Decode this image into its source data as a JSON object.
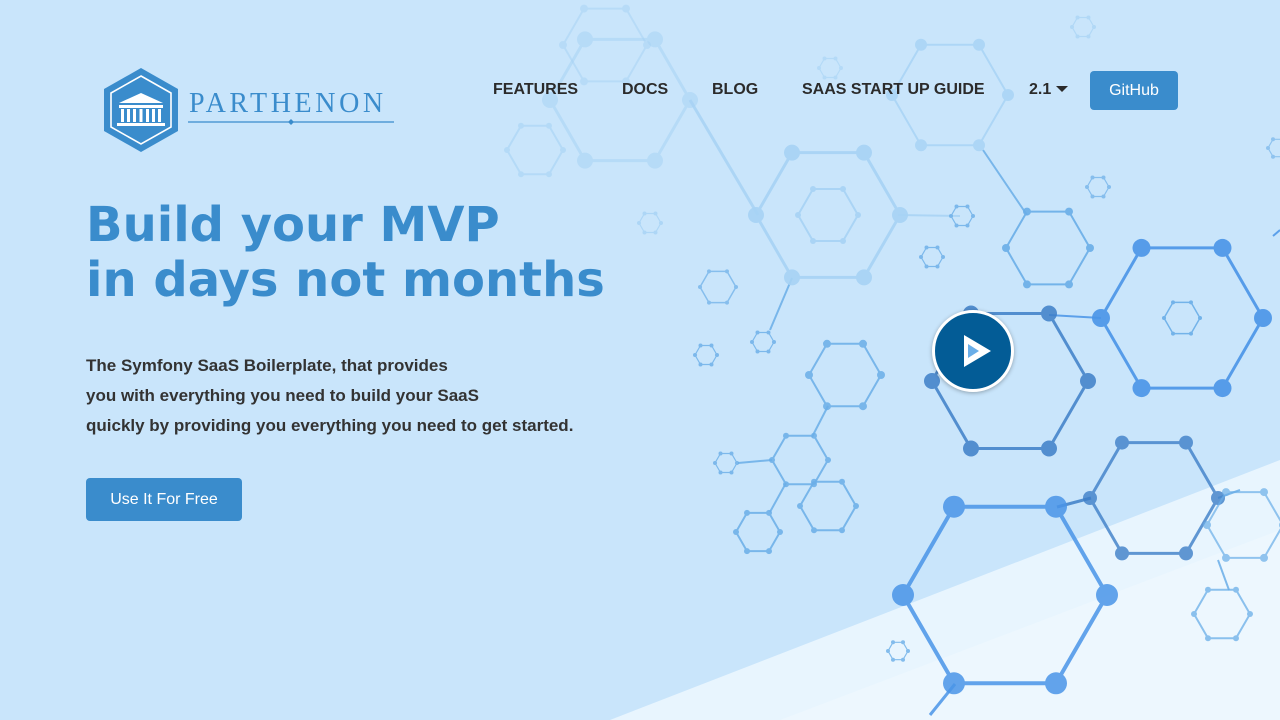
{
  "brand": {
    "name": "PARTHENON",
    "logo_icon": "parthenon-temple-icon"
  },
  "nav": {
    "items": [
      {
        "label": "FEATURES"
      },
      {
        "label": "DOCS"
      },
      {
        "label": "BLOG"
      },
      {
        "label": "SAAS START UP GUIDE"
      }
    ],
    "version": "2.1",
    "github_label": "GitHub"
  },
  "hero": {
    "title_line1": "Build your MVP",
    "title_line2": "in days not months",
    "description_lines": [
      "The Symfony SaaS Boilerplate, that provides",
      "you with everything you need to build your SaaS",
      "quickly by providing you everything you need to get started."
    ],
    "cta_label": "Use It For Free",
    "play_icon": "play-icon"
  },
  "colors": {
    "background": "#c9e5fb",
    "accent": "#3a8ccc",
    "play_button": "#035c96",
    "text_dark": "#333333",
    "molecule_light": "#a7d3f5",
    "molecule_mid": "#6aaee8",
    "molecule_bright": "#4a95e8",
    "molecule_dark": "#3e7fc8"
  }
}
